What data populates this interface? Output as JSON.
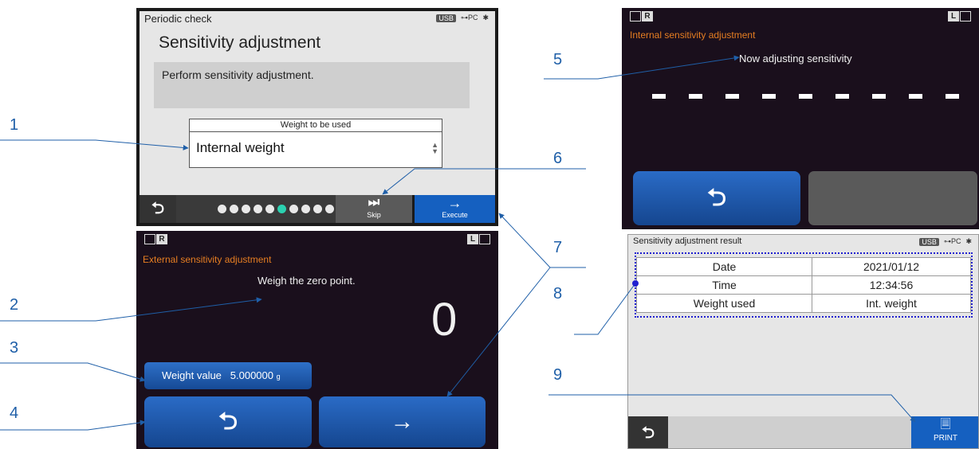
{
  "panel1": {
    "title": "Periodic check",
    "status": {
      "usb": "USB",
      "pc": "PC",
      "bluetooth_icon": "bluetooth-icon"
    },
    "heading": "Sensitivity adjustment",
    "message": "Perform sensitivity adjustment.",
    "weight_label": "Weight to be used",
    "weight_value": "Internal weight",
    "skip_label": "Skip",
    "execute_label": "Execute",
    "progress": {
      "total_steps": 10,
      "current_step": 6
    }
  },
  "panel2": {
    "mode_left": "R",
    "mode_right": "L",
    "title": "External sensitivity adjustment",
    "instruction": "Weigh the zero point.",
    "reading": "0",
    "weight_value_label": "Weight value",
    "weight_value": "5.000000",
    "weight_unit": "g"
  },
  "panel5": {
    "mode_left": "R",
    "mode_right": "L",
    "title": "Internal sensitivity adjustment",
    "status": "Now adjusting sensitivity",
    "dash_count": 9
  },
  "panel8": {
    "title": "Sensitivity adjustment result",
    "status": {
      "usb": "USB",
      "pc": "PC"
    },
    "rows": [
      {
        "label": "Date",
        "value": "2021/01/12"
      },
      {
        "label": "Time",
        "value": "12:34:56"
      },
      {
        "label": "Weight used",
        "value": "Int. weight"
      }
    ],
    "print_label": "PRINT"
  },
  "callouts": [
    "1",
    "2",
    "3",
    "4",
    "5",
    "6",
    "7",
    "8",
    "9"
  ],
  "colors": {
    "accent_blue": "#1560c0",
    "title_orange": "#e67e22",
    "callout_blue": "#1f5fa8",
    "dark_bg": "#1a0f1c"
  }
}
